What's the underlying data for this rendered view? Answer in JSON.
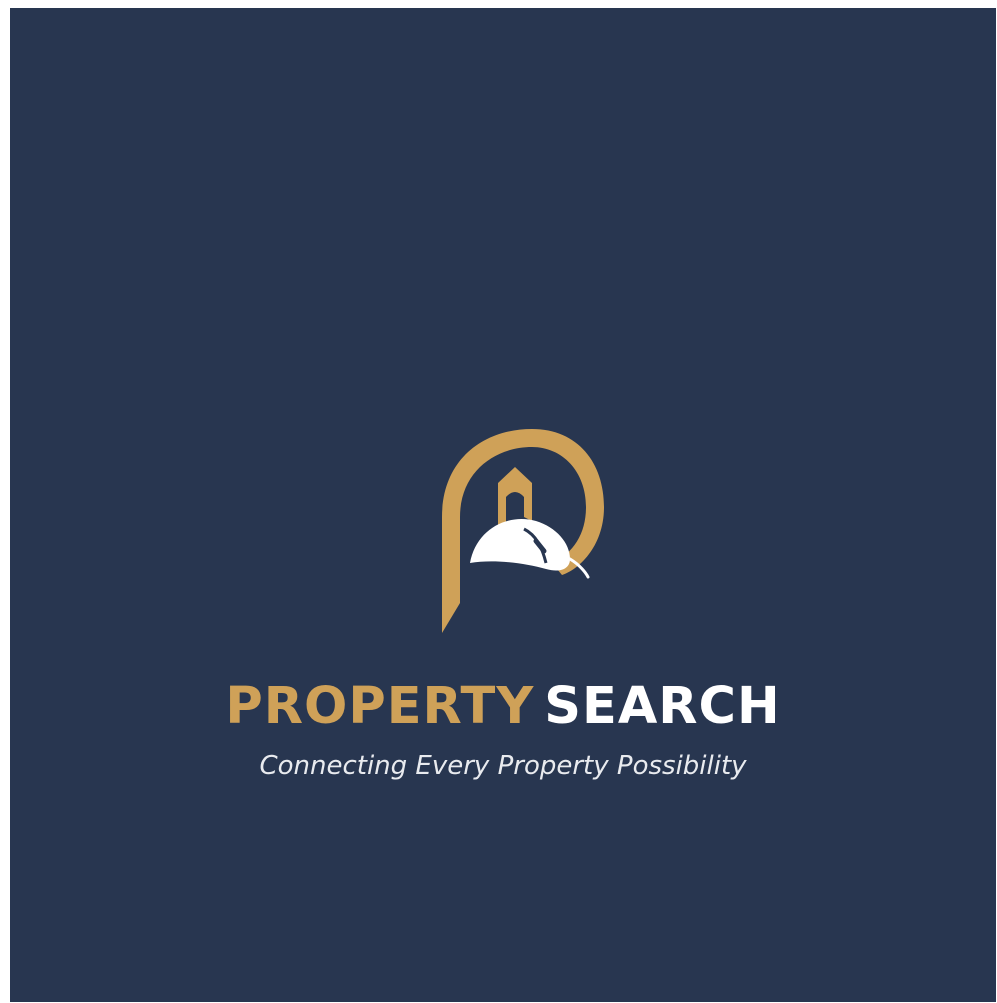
{
  "brand": {
    "name_part_1": "PROPERTY",
    "name_part_2": "SEARCH",
    "tagline": "Connecting Every Property Possibility",
    "logo_icon": "p-house-mouse-icon"
  },
  "colors": {
    "background": "#283650",
    "gold": "#cfa158",
    "white": "#ffffff"
  }
}
